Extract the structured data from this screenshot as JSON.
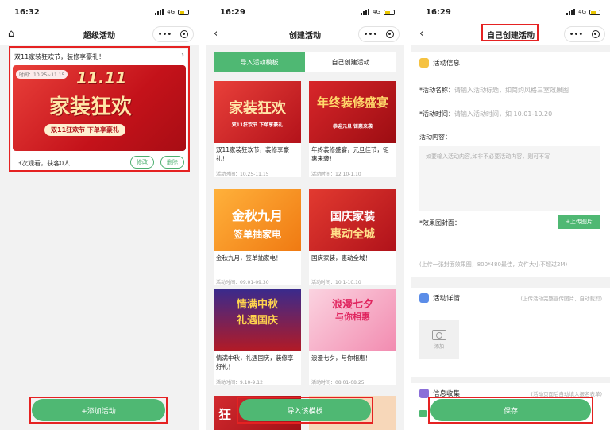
{
  "status_times": [
    "16:32",
    "16:29",
    "16:29"
  ],
  "network": "4G",
  "screen1": {
    "title": "超级活动",
    "card": {
      "title": "双11家装狂欢节，装修享豪礼！",
      "banner_pill": "时间：10.25~11.15",
      "banner_title": "家装狂欢",
      "banner_number": "11.11",
      "banner_sub": "双11狂欢节 下单享豪礼",
      "meta": "3次观看，获客0人",
      "edit_label": "修改",
      "delete_label": "删除"
    },
    "add_label": "+添加活动"
  },
  "screen2": {
    "title": "创建活动",
    "tabs": [
      "导入活动模板",
      "自己创建活动"
    ],
    "templates": [
      {
        "title": "双11家装狂欢节，装修享豪礼！",
        "date": "活动时间：10.25-11.15",
        "thumb": "家装狂欢",
        "thumb_sub": "双11狂欢节 下单享豪礼"
      },
      {
        "title": "年终装修盛宴，元旦佳节，钜惠来袭！",
        "date": "活动时间：12.10-1.10",
        "thumb": "年终装修盛宴",
        "thumb_sub": "恭迎元旦 钜惠来袭"
      },
      {
        "title": "金秋九月，签单抽家电！",
        "date": "活动时间：09.01-09.30",
        "thumb": "金秋九月",
        "thumb_sub": "签单抽家电"
      },
      {
        "title": "国庆家装，惠动全城！",
        "date": "活动时间：10.1-10.10",
        "thumb": "国庆家装",
        "thumb_sub": "惠动全城"
      },
      {
        "title": "情满中秋，礼遇国庆，装修享好礼！",
        "date": "活动时间：9.10-9.12",
        "thumb": "情满中秋",
        "thumb_sub": "礼遇国庆"
      },
      {
        "title": "浪漫七夕，与你相惠！",
        "date": "活动时间：08.01-08.25",
        "thumb": "浪漫七夕",
        "thumb_sub": "与你相惠"
      }
    ],
    "import_label": "导入该模板",
    "peek_thumb": "狂"
  },
  "screen3": {
    "title": "自己创建活动",
    "section_info": "活动信息",
    "name_label": "*活动名称：",
    "name_placeholder": "请输入活动标题，如简约风格三室效果图",
    "time_label": "*活动时间：",
    "time_placeholder": "请输入活动时间，如 10.01-10.20",
    "content_label": "活动内容：",
    "content_placeholder": "如要输入活动内容,如非不必要活动内容，则可不写",
    "cover_label": "*效果图封面：",
    "upload_label": "+上传图片",
    "upload_hint": "(上传一张封面效果图，800*480最佳，文件大小不超过2M)",
    "section_detail": "活动详情",
    "detail_hint": "(上传活动完整宣传图片，自动裁剪)",
    "add_image_label": "添加",
    "section_collect": "信息收集",
    "collect_hint": "(活动页面后自动填入报名表单)",
    "save_label": "保存"
  }
}
